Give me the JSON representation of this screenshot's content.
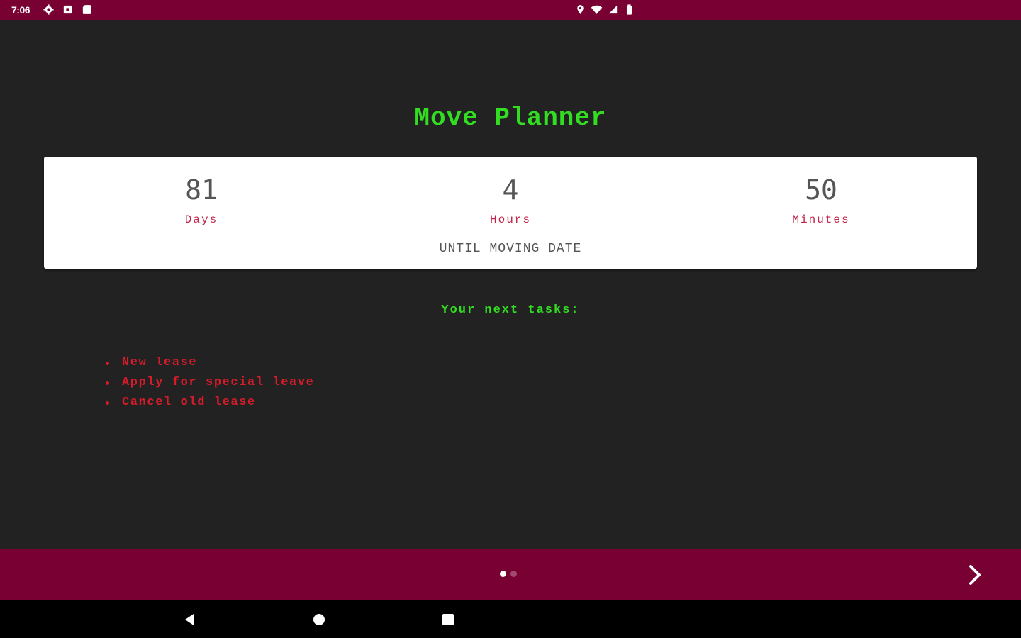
{
  "status_bar": {
    "time": "7:06",
    "background": "#780033",
    "left_icons": [
      "settings-icon",
      "media-icon",
      "sd-card-icon"
    ],
    "right_icons": [
      "location-icon",
      "wifi-icon",
      "signal-icon",
      "battery-icon"
    ]
  },
  "app": {
    "title": "Move Planner",
    "title_color": "#33dd22",
    "background": "#222222"
  },
  "countdown": {
    "days": {
      "value": "81",
      "label": "Days"
    },
    "hours": {
      "value": "4",
      "label": "Hours"
    },
    "minutes": {
      "value": "50",
      "label": "Minutes"
    },
    "caption": "UNTIL MOVING DATE",
    "unit_color": "#c0244b"
  },
  "tasks": {
    "heading": "Your next tasks:",
    "items": [
      {
        "label": "New lease"
      },
      {
        "label": "Apply for special leave"
      },
      {
        "label": "Cancel old lease"
      }
    ],
    "color": "#d61c2a"
  },
  "pager": {
    "page_count": 2,
    "active_page": 1,
    "next_icon": "chevron-right-icon",
    "background": "#780033"
  },
  "nav_bar": {
    "buttons": [
      "back-icon",
      "home-icon",
      "recents-icon"
    ]
  }
}
